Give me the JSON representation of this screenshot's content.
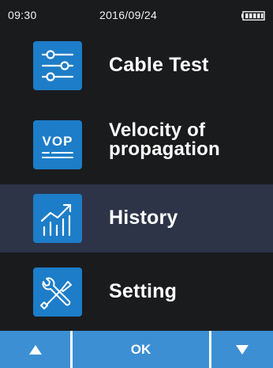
{
  "status": {
    "time": "09:30",
    "date": "2016/09/24",
    "battery_icon": "battery-full-icon"
  },
  "menu": {
    "items": [
      {
        "label": "Cable Test",
        "icon": "sliders-icon"
      },
      {
        "label_line1": "Velocity of",
        "label_line2": "propagation",
        "icon": "vop-icon",
        "icon_text": "VOP"
      },
      {
        "label": "History",
        "icon": "chart-trend-icon"
      },
      {
        "label": "Setting",
        "icon": "tools-icon"
      }
    ],
    "selected_index": 2
  },
  "softkeys": {
    "up_icon": "triangle-up-icon",
    "ok_label": "OK",
    "down_icon": "triangle-down-icon"
  },
  "colors": {
    "background": "#1a1b1d",
    "selected_row": "#2d3448",
    "icon_tile": "#1d7dc8",
    "softkey": "#3c8fd2"
  }
}
